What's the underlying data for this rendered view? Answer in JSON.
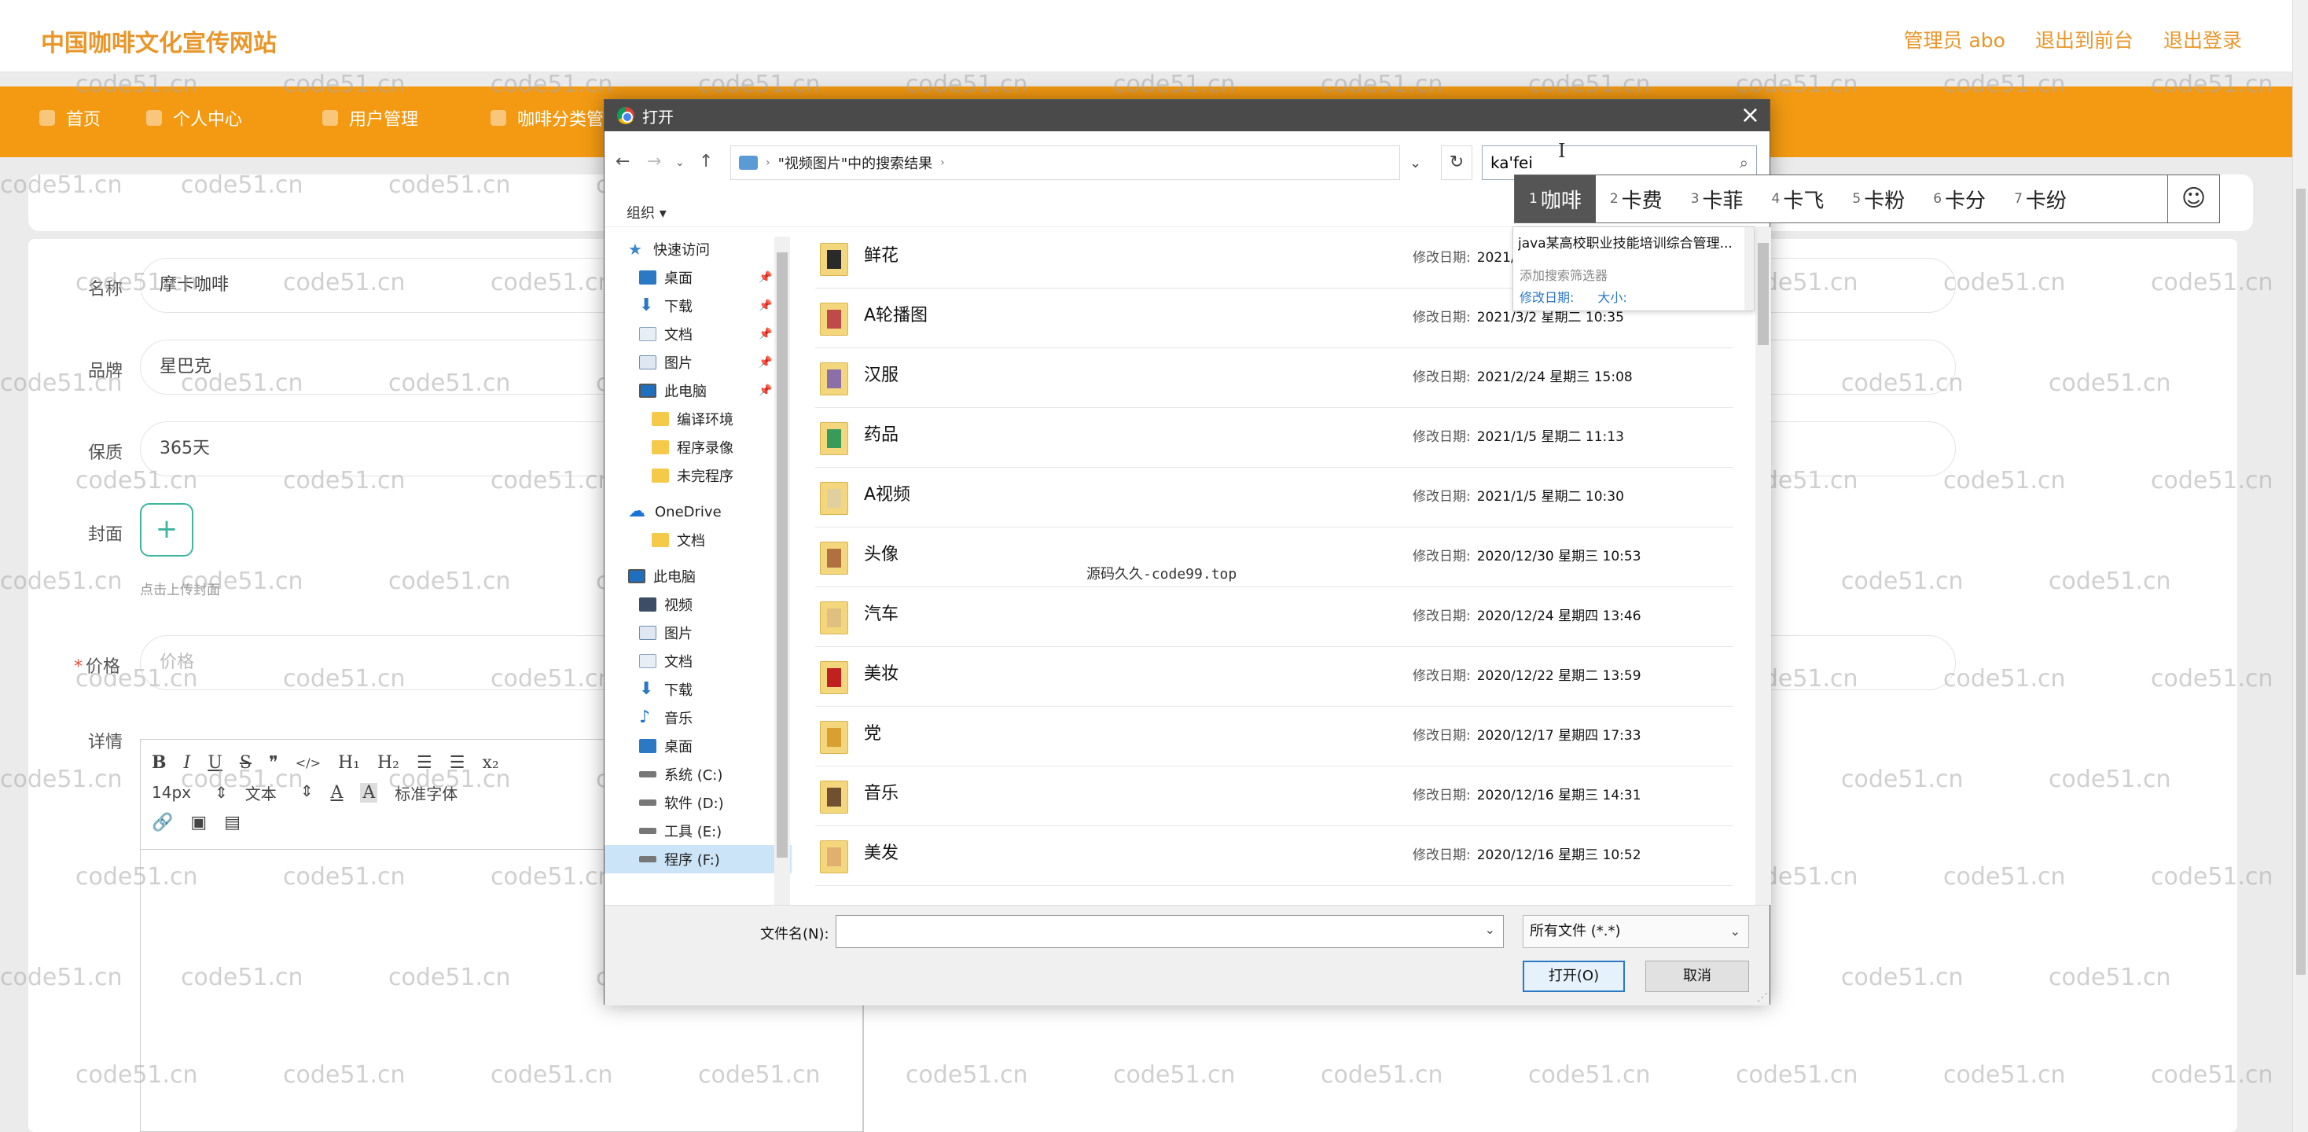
{
  "site": {
    "title": "中国咖啡文化宣传网站",
    "top_links": [
      "管理员 abo",
      "退出到前台",
      "退出登录"
    ]
  },
  "nav": {
    "items": [
      {
        "label": "首页",
        "icon": "home-icon"
      },
      {
        "label": "个人中心",
        "icon": "user-icon"
      },
      {
        "label": "用户管理",
        "icon": "users-icon"
      },
      {
        "label": "咖啡分类管",
        "icon": "category-icon"
      }
    ]
  },
  "form": {
    "name_label": "名称",
    "name_value": "摩卡咖啡",
    "brand_label": "品牌",
    "brand_value": "星巴克",
    "shelf_label": "保质",
    "shelf_value": "365天",
    "cover_label": "封面",
    "cover_hint": "点击上传封面",
    "price_required": "*",
    "price_label": "价格",
    "price_placeholder": "价格",
    "detail_label": "详情"
  },
  "editor": {
    "toolbar_row1": [
      "B",
      "I",
      "U",
      "S",
      "❞",
      "</>",
      "H₁",
      "H₂",
      "☰",
      "☰",
      "x₂"
    ],
    "font_size": "14px",
    "text_type": "文本",
    "font_family": "标准字体",
    "toolbar_row3_icons": [
      "link-icon",
      "image-icon",
      "video-icon"
    ]
  },
  "watermark": "code51.cn",
  "center_watermark": "源码久久-code99.top",
  "dialog": {
    "title": "打开",
    "address": "\"视频图片\"中的搜索结果",
    "search_value": "ka'fei",
    "organize": "组织",
    "nav_pane": [
      {
        "label": "快速访问",
        "icon": "star-icon",
        "pinned": false
      },
      {
        "label": "桌面",
        "icon": "desktop-icon",
        "pinned": true
      },
      {
        "label": "下载",
        "icon": "download-icon",
        "pinned": true
      },
      {
        "label": "文档",
        "icon": "document-icon",
        "pinned": true
      },
      {
        "label": "图片",
        "icon": "pictures-icon",
        "pinned": true
      },
      {
        "label": "此电脑",
        "icon": "pc-icon",
        "pinned": true
      },
      {
        "label": "编译环境",
        "icon": "folder-icon",
        "pinned": false
      },
      {
        "label": "程序录像",
        "icon": "folder-icon",
        "pinned": false
      },
      {
        "label": "未完程序",
        "icon": "folder-icon",
        "pinned": false
      },
      {
        "label": "OneDrive",
        "icon": "cloud-icon",
        "pinned": false
      },
      {
        "label": "文档",
        "icon": "folder-icon",
        "pinned": false
      },
      {
        "label": "此电脑",
        "icon": "pc-icon",
        "pinned": false
      },
      {
        "label": "视频",
        "icon": "video-icon",
        "pinned": false
      },
      {
        "label": "图片",
        "icon": "pictures-icon",
        "pinned": false
      },
      {
        "label": "文档",
        "icon": "document-icon",
        "pinned": false
      },
      {
        "label": "下载",
        "icon": "download-icon",
        "pinned": false
      },
      {
        "label": "音乐",
        "icon": "music-icon",
        "pinned": false
      },
      {
        "label": "桌面",
        "icon": "desktop-icon",
        "pinned": false
      },
      {
        "label": "系统 (C:)",
        "icon": "drive-icon",
        "pinned": false
      },
      {
        "label": "软件 (D:)",
        "icon": "drive-icon",
        "pinned": false
      },
      {
        "label": "工具 (E:)",
        "icon": "drive-icon",
        "pinned": false
      },
      {
        "label": "程序 (F:)",
        "icon": "drive-icon",
        "pinned": false
      }
    ],
    "date_label": "修改日期:",
    "files": [
      {
        "name": "鲜花",
        "date": "2021/3"
      },
      {
        "name": "A轮播图",
        "date": "2021/3/2 星期二 10:35"
      },
      {
        "name": "汉服",
        "date": "2021/2/24 星期三 15:08"
      },
      {
        "name": "药品",
        "date": "2021/1/5 星期二 11:13"
      },
      {
        "name": "A视频",
        "date": "2021/1/5 星期二 10:30"
      },
      {
        "name": "头像",
        "date": "2020/12/30 星期三 10:53"
      },
      {
        "name": "汽车",
        "date": "2020/12/24 星期四 13:46"
      },
      {
        "name": "美妆",
        "date": "2020/12/22 星期二 13:59"
      },
      {
        "name": "党",
        "date": "2020/12/17 星期四 17:33"
      },
      {
        "name": "音乐",
        "date": "2020/12/16 星期三 14:31"
      },
      {
        "name": "美发",
        "date": "2020/12/16 星期三 10:52"
      }
    ],
    "suggest": {
      "top": "java某高校职业技能培训综合管理...",
      "add_filter": "添加搜索筛选器",
      "filter_date": "修改日期:",
      "filter_size": "大小:"
    },
    "filename_label": "文件名(N):",
    "filename_value": "",
    "filetype": "所有文件 (*.*)",
    "open_button": "打开(O)",
    "cancel_button": "取消"
  },
  "ime": {
    "candidates": [
      {
        "num": "1",
        "text": "咖啡"
      },
      {
        "num": "2",
        "text": "卡费"
      },
      {
        "num": "3",
        "text": "卡菲"
      },
      {
        "num": "4",
        "text": "卡飞"
      },
      {
        "num": "5",
        "text": "卡粉"
      },
      {
        "num": "6",
        "text": "卡分"
      },
      {
        "num": "7",
        "text": "卡纷"
      }
    ],
    "emoji": "☺"
  }
}
